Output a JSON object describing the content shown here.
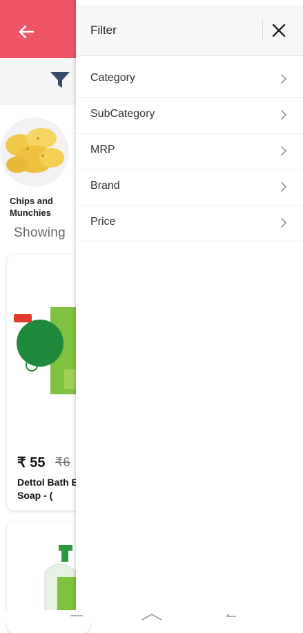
{
  "header": {
    "back_icon": "arrow-left-icon",
    "filter_icon": "funnel-icon",
    "accent": "#ee5569"
  },
  "category": {
    "label": "Chips and Munchies"
  },
  "listing": {
    "showing_text": "Showing"
  },
  "products": [
    {
      "price": "₹ 55",
      "mrp": "₹6",
      "name": "Dettol Bath Bar Soap - ("
    }
  ],
  "drawer": {
    "title": "Filter",
    "close_icon": "close-icon",
    "items": [
      {
        "label": "Category"
      },
      {
        "label": "SubCategory"
      },
      {
        "label": "MRP"
      },
      {
        "label": "Brand"
      },
      {
        "label": "Price"
      }
    ]
  },
  "navbar": {
    "icons": [
      "menu-icon",
      "home-icon",
      "back-icon"
    ]
  }
}
